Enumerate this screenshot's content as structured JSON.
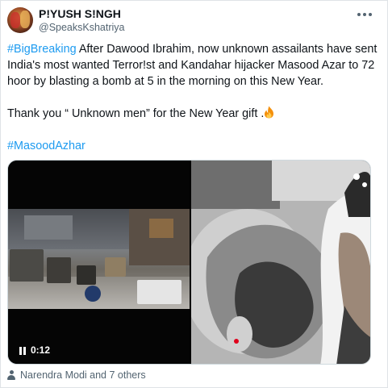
{
  "tweet": {
    "author_name": "P!YUSH S!NGH",
    "author_handle": "@SpeaksKshatriya",
    "hashtag_lead": "#BigBreaking",
    "body_line1": " After Dawood Ibrahim, now unknown assailants have sent India's most wanted Terror!st and Kandahar hijacker Masood Azar to 72 hoor by blasting a bomb at 5 in the morning on this New Year.",
    "body_line2": "Thank you “ Unknown men” for the New Year gift .",
    "hashtag_tail": "#MasoodAzhar",
    "emoji_icon": "fire-emoji"
  },
  "media": {
    "video_duration": "0:12",
    "play_icon": "pause-icon"
  },
  "footer": {
    "liked_by": "Narendra Modi and 7 others",
    "person_icon": "person-icon"
  },
  "colors": {
    "link": "#1d9bf0",
    "text": "#0f1419",
    "muted": "#536471"
  }
}
